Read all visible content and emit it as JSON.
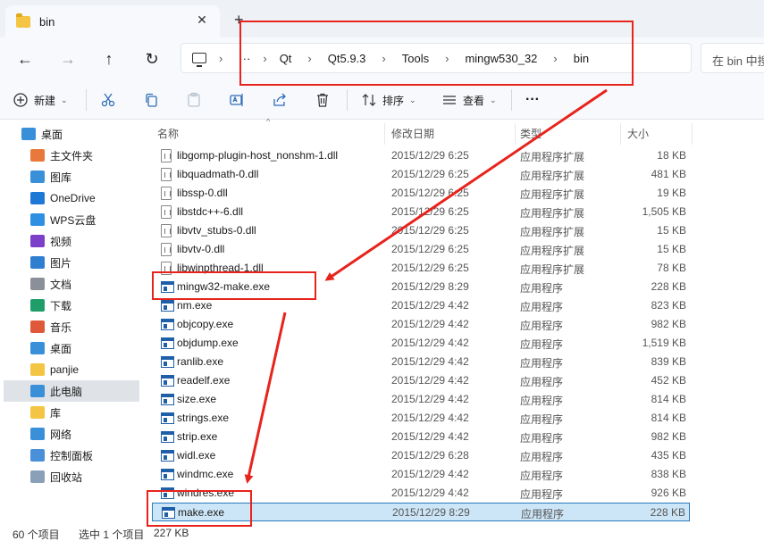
{
  "tab": {
    "title": "bin",
    "close_glyph": "✕",
    "new_glyph": "+"
  },
  "nav": {
    "back": "←",
    "forward": "→",
    "up": "↑",
    "refresh": "↻"
  },
  "breadcrumb": {
    "more": "···",
    "items": [
      "Qt",
      "Qt5.9.3",
      "Tools",
      "mingw530_32",
      "bin"
    ],
    "sep": "›"
  },
  "search": {
    "placeholder": "在 bin 中搜索"
  },
  "toolbar": {
    "new_label": "新建",
    "sort_label": "排序",
    "view_label": "查看",
    "more": "···",
    "icons": [
      "cut-icon",
      "copy-icon",
      "paste-icon",
      "rename-icon",
      "share-icon",
      "delete-icon"
    ]
  },
  "sidebar": {
    "items": [
      {
        "label": "桌面",
        "icon": "desktop-icon",
        "color": "#3a8fd9"
      },
      {
        "label": "主文件夹",
        "icon": "home-icon",
        "color": "#e8793a"
      },
      {
        "label": "图库",
        "icon": "gallery-icon",
        "color": "#3a8fd9"
      },
      {
        "label": "OneDrive",
        "icon": "onedrive-icon",
        "color": "#1e78d6"
      },
      {
        "label": "WPS云盘",
        "icon": "wps-cloud-icon",
        "color": "#2f8fe0"
      },
      {
        "label": "视频",
        "icon": "video-icon",
        "color": "#7b3fc8"
      },
      {
        "label": "图片",
        "icon": "pictures-icon",
        "color": "#2f7fd0"
      },
      {
        "label": "文档",
        "icon": "documents-icon",
        "color": "#8a8f98"
      },
      {
        "label": "下载",
        "icon": "download-icon",
        "color": "#1f9e6a"
      },
      {
        "label": "音乐",
        "icon": "music-icon",
        "color": "#e0583a"
      },
      {
        "label": "桌面",
        "icon": "desktop-icon",
        "color": "#3a8fd9"
      },
      {
        "label": "panjie",
        "icon": "folder-icon",
        "color": "#f4c542"
      },
      {
        "label": "此电脑",
        "icon": "this-pc-icon",
        "color": "#3a8fd9"
      },
      {
        "label": "库",
        "icon": "library-icon",
        "color": "#f4c542"
      },
      {
        "label": "网络",
        "icon": "network-icon",
        "color": "#3a8fd9"
      },
      {
        "label": "控制面板",
        "icon": "control-panel-icon",
        "color": "#4a90d9"
      },
      {
        "label": "回收站",
        "icon": "recycle-bin-icon",
        "color": "#8aa0b8"
      }
    ]
  },
  "columns": {
    "name": "名称",
    "date": "修改日期",
    "type": "类型",
    "size": "大小"
  },
  "files": [
    {
      "name": "libgomp-plugin-host_nonshm-1.dll",
      "date": "2015/12/29 6:25",
      "type": "应用程序扩展",
      "size": "18 KB",
      "kind": "dll"
    },
    {
      "name": "libquadmath-0.dll",
      "date": "2015/12/29 6:25",
      "type": "应用程序扩展",
      "size": "481 KB",
      "kind": "dll"
    },
    {
      "name": "libssp-0.dll",
      "date": "2015/12/29 6:25",
      "type": "应用程序扩展",
      "size": "19 KB",
      "kind": "dll"
    },
    {
      "name": "libstdc++-6.dll",
      "date": "2015/12/29 6:25",
      "type": "应用程序扩展",
      "size": "1,505 KB",
      "kind": "dll"
    },
    {
      "name": "libvtv_stubs-0.dll",
      "date": "2015/12/29 6:25",
      "type": "应用程序扩展",
      "size": "15 KB",
      "kind": "dll"
    },
    {
      "name": "libvtv-0.dll",
      "date": "2015/12/29 6:25",
      "type": "应用程序扩展",
      "size": "15 KB",
      "kind": "dll"
    },
    {
      "name": "libwinpthread-1.dll",
      "date": "2015/12/29 6:25",
      "type": "应用程序扩展",
      "size": "78 KB",
      "kind": "dll"
    },
    {
      "name": "mingw32-make.exe",
      "date": "2015/12/29 8:29",
      "type": "应用程序",
      "size": "228 KB",
      "kind": "exe"
    },
    {
      "name": "nm.exe",
      "date": "2015/12/29 4:42",
      "type": "应用程序",
      "size": "823 KB",
      "kind": "exe"
    },
    {
      "name": "objcopy.exe",
      "date": "2015/12/29 4:42",
      "type": "应用程序",
      "size": "982 KB",
      "kind": "exe"
    },
    {
      "name": "objdump.exe",
      "date": "2015/12/29 4:42",
      "type": "应用程序",
      "size": "1,519 KB",
      "kind": "exe"
    },
    {
      "name": "ranlib.exe",
      "date": "2015/12/29 4:42",
      "type": "应用程序",
      "size": "839 KB",
      "kind": "exe"
    },
    {
      "name": "readelf.exe",
      "date": "2015/12/29 4:42",
      "type": "应用程序",
      "size": "452 KB",
      "kind": "exe"
    },
    {
      "name": "size.exe",
      "date": "2015/12/29 4:42",
      "type": "应用程序",
      "size": "814 KB",
      "kind": "exe"
    },
    {
      "name": "strings.exe",
      "date": "2015/12/29 4:42",
      "type": "应用程序",
      "size": "814 KB",
      "kind": "exe"
    },
    {
      "name": "strip.exe",
      "date": "2015/12/29 4:42",
      "type": "应用程序",
      "size": "982 KB",
      "kind": "exe"
    },
    {
      "name": "widl.exe",
      "date": "2015/12/29 6:28",
      "type": "应用程序",
      "size": "435 KB",
      "kind": "exe"
    },
    {
      "name": "windmc.exe",
      "date": "2015/12/29 4:42",
      "type": "应用程序",
      "size": "838 KB",
      "kind": "exe"
    },
    {
      "name": "windres.exe",
      "date": "2015/12/29 4:42",
      "type": "应用程序",
      "size": "926 KB",
      "kind": "exe"
    },
    {
      "name": "make.exe",
      "date": "2015/12/29 8:29",
      "type": "应用程序",
      "size": "228 KB",
      "kind": "exe",
      "selected": true
    }
  ],
  "status": {
    "count": "60 个项目",
    "selection": "选中 1 个项目",
    "size": "227 KB"
  },
  "annotation_color": "#e8231c"
}
